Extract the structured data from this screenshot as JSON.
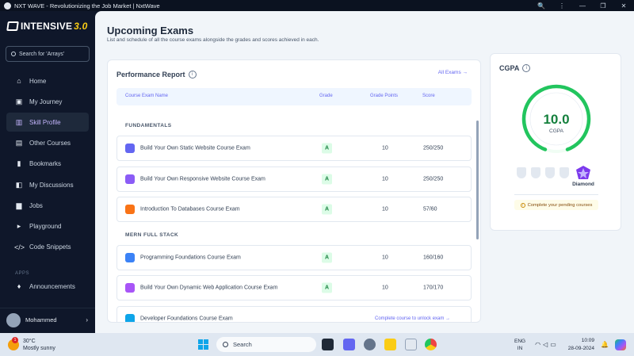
{
  "window": {
    "title": "NXT WAVE - Revolutionizing the Job Market | NxtWave",
    "controls": [
      "🔍",
      "⋮",
      "—",
      "❐",
      "✕"
    ]
  },
  "sidebar": {
    "logo": {
      "name": "INTENSIVE",
      "version": "3.0"
    },
    "search_placeholder": "Search for 'Arrays'",
    "items": [
      {
        "label": "Home",
        "icon": "home-icon",
        "glyph": "⌂"
      },
      {
        "label": "My Journey",
        "icon": "journey-icon",
        "glyph": "▣"
      },
      {
        "label": "Skill Profile",
        "icon": "skill-profile-icon",
        "glyph": "▥",
        "active": true
      },
      {
        "label": "Other Courses",
        "icon": "book-icon",
        "glyph": "▤"
      },
      {
        "label": "Bookmarks",
        "icon": "bookmark-icon",
        "glyph": "▮"
      },
      {
        "label": "My Discussions",
        "icon": "discussion-icon",
        "glyph": "◧"
      },
      {
        "label": "Jobs",
        "icon": "briefcase-icon",
        "glyph": "▆"
      },
      {
        "label": "Playground",
        "icon": "terminal-icon",
        "glyph": "▸"
      },
      {
        "label": "Code Snippets",
        "icon": "code-icon",
        "glyph": "</>"
      }
    ],
    "apps_label": "APPS",
    "apps": [
      {
        "label": "Announcements",
        "icon": "bell-icon",
        "glyph": "♦"
      }
    ],
    "user": {
      "name": "Mohammed"
    }
  },
  "main": {
    "title": "Upcoming Exams",
    "subtitle": "List and schedule of all the course exams alongside the grades and scores achieved in each.",
    "performance": {
      "title": "Performance Report",
      "all_exams_link": "All Exams →",
      "headers": {
        "name": "Course Exam Name",
        "grade": "Grade",
        "points": "Grade Points",
        "score": "Score"
      },
      "sections": [
        {
          "label": "FUNDAMENTALS",
          "rows": [
            {
              "name": "Build Your Own Static Website Course Exam",
              "grade": "A",
              "points": "10",
              "score": "250/250",
              "icon_color": "#6366f1"
            },
            {
              "name": "Build Your Own Responsive Website Course Exam",
              "grade": "A",
              "points": "10",
              "score": "250/250",
              "icon_color": "#8b5cf6"
            },
            {
              "name": "Introduction To Databases Course Exam",
              "grade": "A",
              "points": "10",
              "score": "57/60",
              "icon_color": "#f97316"
            }
          ]
        },
        {
          "label": "MERN FULL STACK",
          "rows": [
            {
              "name": "Programming Foundations Course Exam",
              "grade": "A",
              "points": "10",
              "score": "160/160",
              "icon_color": "#3b82f6"
            },
            {
              "name": "Build Your Own Dynamic Web Application Course Exam",
              "grade": "A",
              "points": "10",
              "score": "170/170",
              "icon_color": "#a855f7"
            },
            {
              "name": "Developer Foundations Course Exam",
              "hint": "Complete course to unlock exam →",
              "icon_color": "#0ea5e9"
            }
          ]
        }
      ]
    },
    "cgpa": {
      "title": "CGPA",
      "value": "10.0",
      "label": "CGPA",
      "fraction": 1.0,
      "badge_label": "Diamond",
      "pending": "Complete your pending courses",
      "colors": {
        "gauge": "#22c55e",
        "diamond": "#7c3aed"
      }
    }
  },
  "taskbar": {
    "weather": {
      "temp": "30°C",
      "desc": "Mostly sunny",
      "notif": "1"
    },
    "search": "Search",
    "lang": {
      "line1": "ENG",
      "line2": "IN"
    },
    "time": "10:09",
    "date": "28-09-2024"
  }
}
